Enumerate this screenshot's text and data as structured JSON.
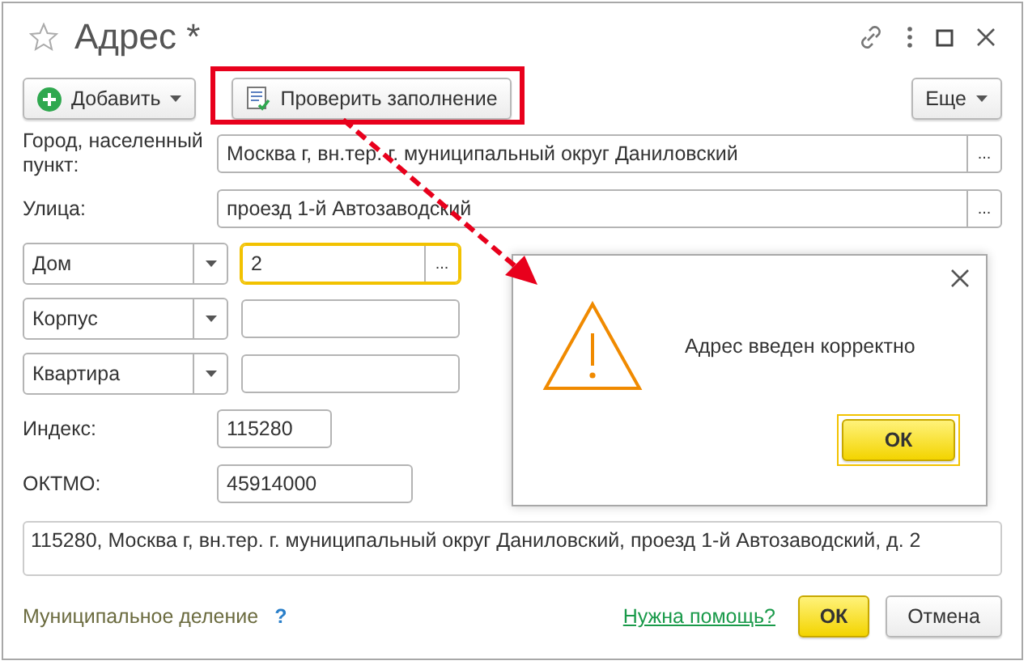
{
  "window": {
    "title": "Адрес *"
  },
  "toolbar": {
    "buttons": [
      {
        "label": "Добавить",
        "kind": "add"
      },
      {
        "label": "Проверить заполнение",
        "kind": "check",
        "highlighted": true
      }
    ],
    "more": "Еще"
  },
  "fields": [
    {
      "kind": "text",
      "label": "Город, населенный пункт:",
      "value": "Москва г, вн.тер. г. муниципальный округ Даниловский",
      "picker": "..."
    },
    {
      "kind": "text",
      "label": "Улица:",
      "value": "проезд 1-й Автозаводский",
      "picker": "..."
    },
    {
      "kind": "select",
      "label": "Дом",
      "value": "2",
      "focused": true,
      "picker": "..."
    },
    {
      "kind": "select",
      "label": "Корпус",
      "focused": false
    },
    {
      "kind": "select",
      "label": "Квартира",
      "focused": false
    },
    {
      "kind": "short",
      "label": "Индекс:",
      "value": "115280"
    },
    {
      "kind": "medium",
      "label": "ОКТМО:",
      "value": "45914000"
    }
  ],
  "full_address": "115280, Москва г, вн.тер. г. муниципальный округ Даниловский, проезд 1-й Автозаводский, д. 2",
  "footer": {
    "link": "Муниципальное деление",
    "help_mark": "?",
    "help_link": "Нужна помощь?",
    "buttons": [
      {
        "label": "ОК",
        "kind": "default"
      },
      {
        "label": "Отмена",
        "kind": "normal"
      }
    ]
  },
  "dialog": {
    "message": "Адрес введен корректно",
    "button": "ОК"
  }
}
